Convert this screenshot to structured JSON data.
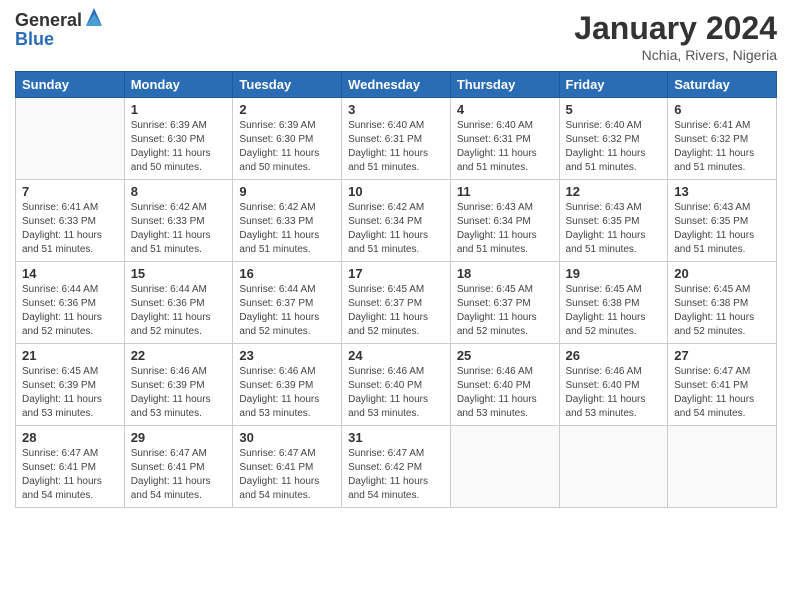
{
  "logo": {
    "general": "General",
    "blue": "Blue"
  },
  "title": "January 2024",
  "location": "Nchia, Rivers, Nigeria",
  "days_of_week": [
    "Sunday",
    "Monday",
    "Tuesday",
    "Wednesday",
    "Thursday",
    "Friday",
    "Saturday"
  ],
  "weeks": [
    [
      {
        "day": "",
        "sunrise": "",
        "sunset": "",
        "daylight": ""
      },
      {
        "day": "1",
        "sunrise": "Sunrise: 6:39 AM",
        "sunset": "Sunset: 6:30 PM",
        "daylight": "Daylight: 11 hours and 50 minutes."
      },
      {
        "day": "2",
        "sunrise": "Sunrise: 6:39 AM",
        "sunset": "Sunset: 6:30 PM",
        "daylight": "Daylight: 11 hours and 50 minutes."
      },
      {
        "day": "3",
        "sunrise": "Sunrise: 6:40 AM",
        "sunset": "Sunset: 6:31 PM",
        "daylight": "Daylight: 11 hours and 51 minutes."
      },
      {
        "day": "4",
        "sunrise": "Sunrise: 6:40 AM",
        "sunset": "Sunset: 6:31 PM",
        "daylight": "Daylight: 11 hours and 51 minutes."
      },
      {
        "day": "5",
        "sunrise": "Sunrise: 6:40 AM",
        "sunset": "Sunset: 6:32 PM",
        "daylight": "Daylight: 11 hours and 51 minutes."
      },
      {
        "day": "6",
        "sunrise": "Sunrise: 6:41 AM",
        "sunset": "Sunset: 6:32 PM",
        "daylight": "Daylight: 11 hours and 51 minutes."
      }
    ],
    [
      {
        "day": "7",
        "sunrise": "Sunrise: 6:41 AM",
        "sunset": "Sunset: 6:33 PM",
        "daylight": "Daylight: 11 hours and 51 minutes."
      },
      {
        "day": "8",
        "sunrise": "Sunrise: 6:42 AM",
        "sunset": "Sunset: 6:33 PM",
        "daylight": "Daylight: 11 hours and 51 minutes."
      },
      {
        "day": "9",
        "sunrise": "Sunrise: 6:42 AM",
        "sunset": "Sunset: 6:33 PM",
        "daylight": "Daylight: 11 hours and 51 minutes."
      },
      {
        "day": "10",
        "sunrise": "Sunrise: 6:42 AM",
        "sunset": "Sunset: 6:34 PM",
        "daylight": "Daylight: 11 hours and 51 minutes."
      },
      {
        "day": "11",
        "sunrise": "Sunrise: 6:43 AM",
        "sunset": "Sunset: 6:34 PM",
        "daylight": "Daylight: 11 hours and 51 minutes."
      },
      {
        "day": "12",
        "sunrise": "Sunrise: 6:43 AM",
        "sunset": "Sunset: 6:35 PM",
        "daylight": "Daylight: 11 hours and 51 minutes."
      },
      {
        "day": "13",
        "sunrise": "Sunrise: 6:43 AM",
        "sunset": "Sunset: 6:35 PM",
        "daylight": "Daylight: 11 hours and 51 minutes."
      }
    ],
    [
      {
        "day": "14",
        "sunrise": "Sunrise: 6:44 AM",
        "sunset": "Sunset: 6:36 PM",
        "daylight": "Daylight: 11 hours and 52 minutes."
      },
      {
        "day": "15",
        "sunrise": "Sunrise: 6:44 AM",
        "sunset": "Sunset: 6:36 PM",
        "daylight": "Daylight: 11 hours and 52 minutes."
      },
      {
        "day": "16",
        "sunrise": "Sunrise: 6:44 AM",
        "sunset": "Sunset: 6:37 PM",
        "daylight": "Daylight: 11 hours and 52 minutes."
      },
      {
        "day": "17",
        "sunrise": "Sunrise: 6:45 AM",
        "sunset": "Sunset: 6:37 PM",
        "daylight": "Daylight: 11 hours and 52 minutes."
      },
      {
        "day": "18",
        "sunrise": "Sunrise: 6:45 AM",
        "sunset": "Sunset: 6:37 PM",
        "daylight": "Daylight: 11 hours and 52 minutes."
      },
      {
        "day": "19",
        "sunrise": "Sunrise: 6:45 AM",
        "sunset": "Sunset: 6:38 PM",
        "daylight": "Daylight: 11 hours and 52 minutes."
      },
      {
        "day": "20",
        "sunrise": "Sunrise: 6:45 AM",
        "sunset": "Sunset: 6:38 PM",
        "daylight": "Daylight: 11 hours and 52 minutes."
      }
    ],
    [
      {
        "day": "21",
        "sunrise": "Sunrise: 6:45 AM",
        "sunset": "Sunset: 6:39 PM",
        "daylight": "Daylight: 11 hours and 53 minutes."
      },
      {
        "day": "22",
        "sunrise": "Sunrise: 6:46 AM",
        "sunset": "Sunset: 6:39 PM",
        "daylight": "Daylight: 11 hours and 53 minutes."
      },
      {
        "day": "23",
        "sunrise": "Sunrise: 6:46 AM",
        "sunset": "Sunset: 6:39 PM",
        "daylight": "Daylight: 11 hours and 53 minutes."
      },
      {
        "day": "24",
        "sunrise": "Sunrise: 6:46 AM",
        "sunset": "Sunset: 6:40 PM",
        "daylight": "Daylight: 11 hours and 53 minutes."
      },
      {
        "day": "25",
        "sunrise": "Sunrise: 6:46 AM",
        "sunset": "Sunset: 6:40 PM",
        "daylight": "Daylight: 11 hours and 53 minutes."
      },
      {
        "day": "26",
        "sunrise": "Sunrise: 6:46 AM",
        "sunset": "Sunset: 6:40 PM",
        "daylight": "Daylight: 11 hours and 53 minutes."
      },
      {
        "day": "27",
        "sunrise": "Sunrise: 6:47 AM",
        "sunset": "Sunset: 6:41 PM",
        "daylight": "Daylight: 11 hours and 54 minutes."
      }
    ],
    [
      {
        "day": "28",
        "sunrise": "Sunrise: 6:47 AM",
        "sunset": "Sunset: 6:41 PM",
        "daylight": "Daylight: 11 hours and 54 minutes."
      },
      {
        "day": "29",
        "sunrise": "Sunrise: 6:47 AM",
        "sunset": "Sunset: 6:41 PM",
        "daylight": "Daylight: 11 hours and 54 minutes."
      },
      {
        "day": "30",
        "sunrise": "Sunrise: 6:47 AM",
        "sunset": "Sunset: 6:41 PM",
        "daylight": "Daylight: 11 hours and 54 minutes."
      },
      {
        "day": "31",
        "sunrise": "Sunrise: 6:47 AM",
        "sunset": "Sunset: 6:42 PM",
        "daylight": "Daylight: 11 hours and 54 minutes."
      },
      {
        "day": "",
        "sunrise": "",
        "sunset": "",
        "daylight": ""
      },
      {
        "day": "",
        "sunrise": "",
        "sunset": "",
        "daylight": ""
      },
      {
        "day": "",
        "sunrise": "",
        "sunset": "",
        "daylight": ""
      }
    ]
  ]
}
